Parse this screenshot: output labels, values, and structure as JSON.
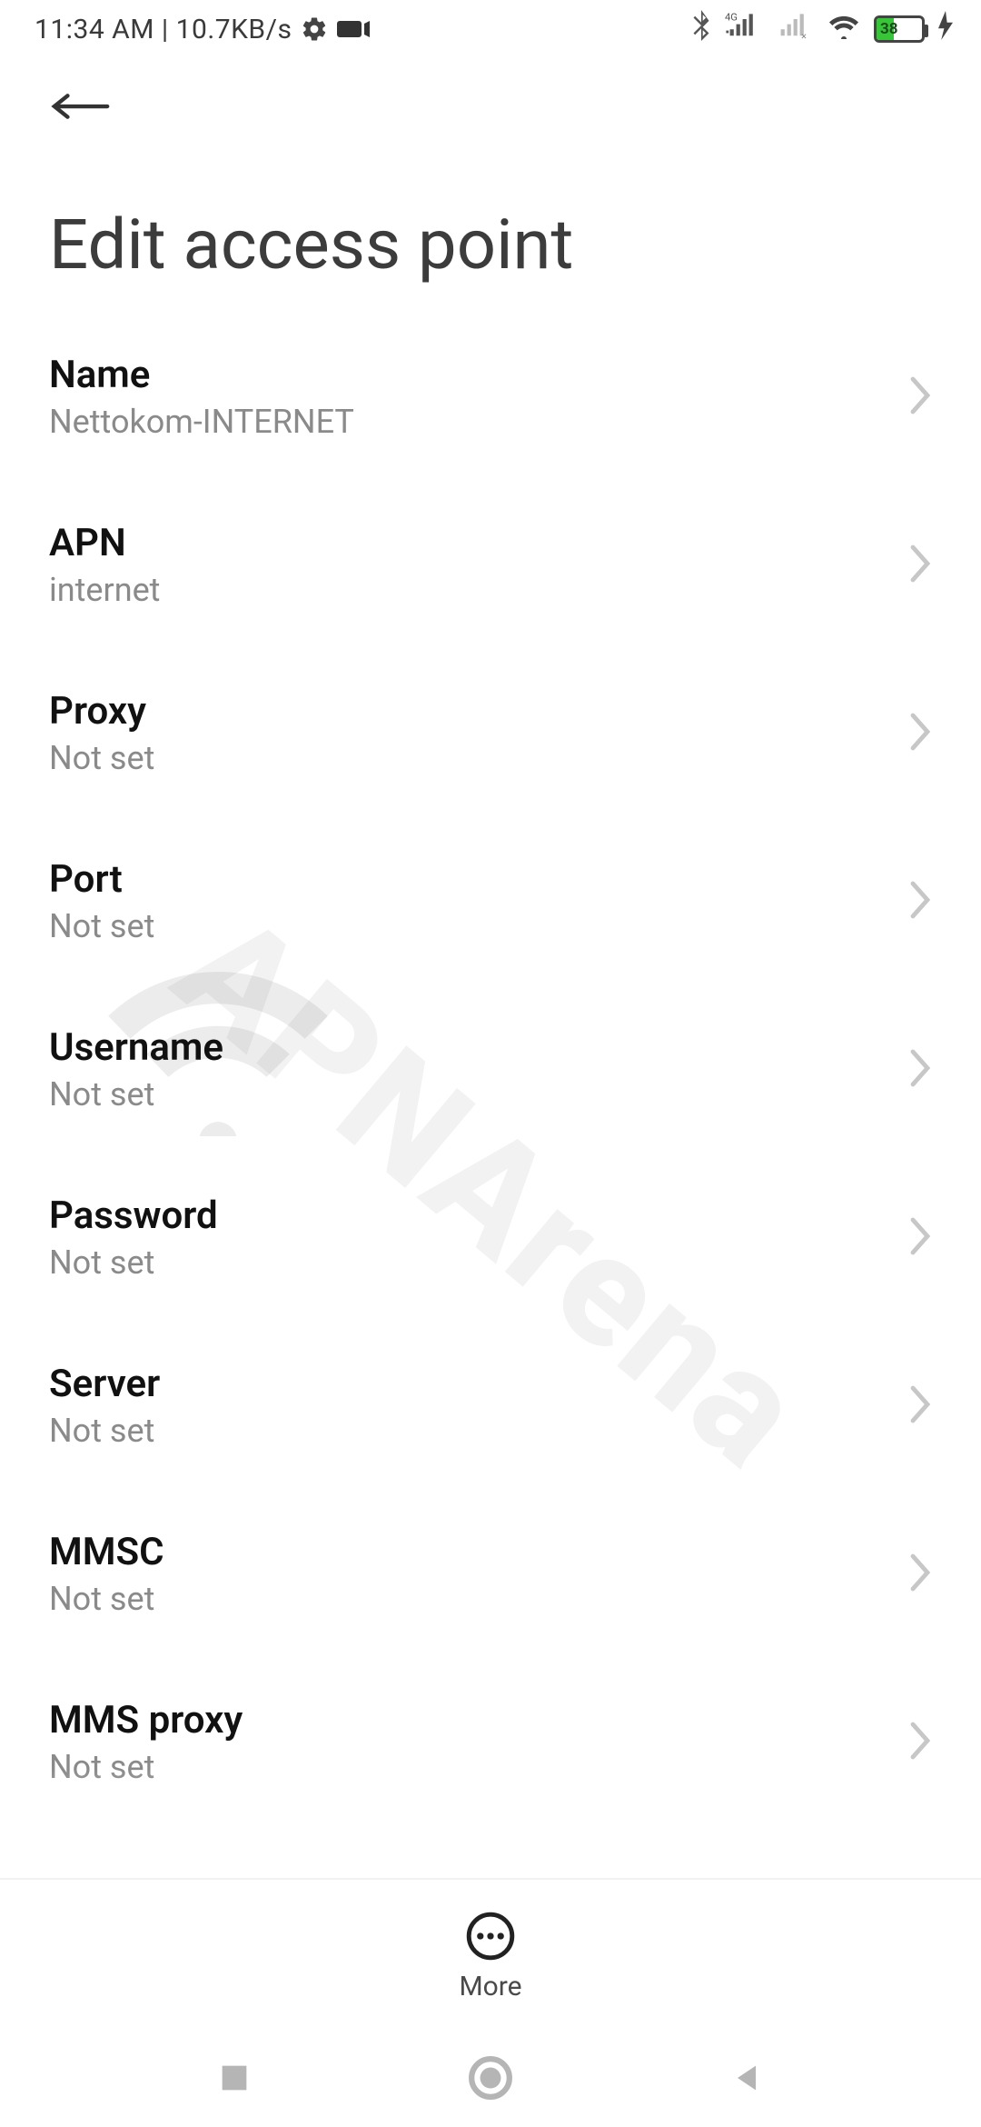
{
  "status": {
    "left_text": "11:34 AM | 10.7KB/s",
    "battery_percent": "38"
  },
  "header": {
    "title": "Edit access point"
  },
  "fields": [
    {
      "label": "Name",
      "value": "Nettokom-INTERNET"
    },
    {
      "label": "APN",
      "value": "internet"
    },
    {
      "label": "Proxy",
      "value": "Not set"
    },
    {
      "label": "Port",
      "value": "Not set"
    },
    {
      "label": "Username",
      "value": "Not set"
    },
    {
      "label": "Password",
      "value": "Not set"
    },
    {
      "label": "Server",
      "value": "Not set"
    },
    {
      "label": "MMSC",
      "value": "Not set"
    },
    {
      "label": "MMS proxy",
      "value": "Not set"
    }
  ],
  "bottom": {
    "more_label": "More"
  },
  "watermark": {
    "text": "APNArena"
  }
}
